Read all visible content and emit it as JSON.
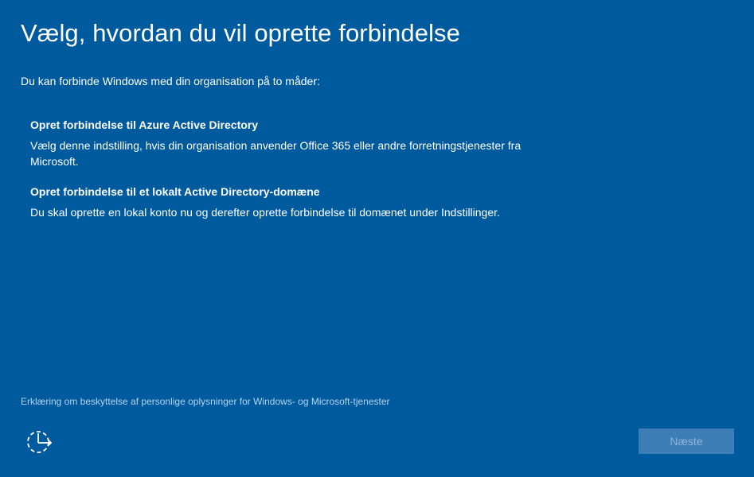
{
  "page": {
    "title": "Vælg, hvordan du vil oprette forbindelse",
    "subtitle": "Du kan forbinde Windows med din organisation på to måder:"
  },
  "options": [
    {
      "heading": "Opret forbindelse til Azure Active Directory",
      "description": "Vælg denne indstilling, hvis din organisation anvender Office 365 eller andre forretningstjenester fra Microsoft."
    },
    {
      "heading": "Opret forbindelse til et lokalt Active Directory-domæne",
      "description": "Du skal oprette en lokal konto nu og derefter oprette forbindelse til domænet under Indstillinger."
    }
  ],
  "footer": {
    "privacy_link": "Erklæring om beskyttelse af personlige oplysninger for Windows- og Microsoft-tjenester",
    "ease_of_access_icon": "ease-of-access-icon",
    "next_label": "Næste",
    "next_enabled": false
  },
  "colors": {
    "background": "#005a9e",
    "text": "#ffffff",
    "link": "#b3d4f0",
    "button_disabled_bg": "#3d7eb7",
    "button_disabled_text": "#8fb4d6"
  }
}
